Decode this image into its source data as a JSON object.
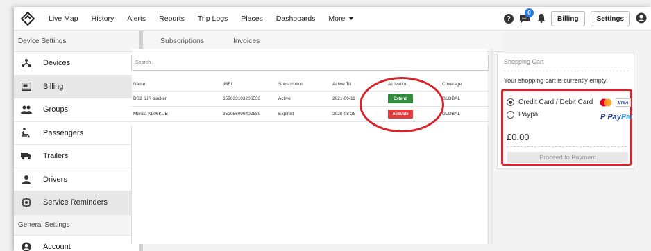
{
  "topnav": {
    "items": [
      "Live Map",
      "History",
      "Alerts",
      "Reports",
      "Trip Logs",
      "Places",
      "Dashboards"
    ],
    "more_label": "More",
    "notification_count": "0",
    "billing_label": "Billing",
    "settings_label": "Settings"
  },
  "sidebar": {
    "device_header": "Device Settings",
    "device_items": [
      {
        "label": "Devices",
        "icon": "devices-icon"
      },
      {
        "label": "Billing",
        "icon": "billing-icon"
      },
      {
        "label": "Groups",
        "icon": "groups-icon"
      },
      {
        "label": "Passengers",
        "icon": "passengers-icon"
      },
      {
        "label": "Trailers",
        "icon": "trailer-icon"
      },
      {
        "label": "Drivers",
        "icon": "driver-icon"
      },
      {
        "label": "Service Reminders",
        "icon": "service-icon"
      }
    ],
    "general_header": "General Settings",
    "general_items": [
      {
        "label": "Account",
        "icon": "account-icon"
      }
    ],
    "active_item": "Billing"
  },
  "tabs": [
    "Subscriptions",
    "Invoices"
  ],
  "search": {
    "placeholder": "Search.."
  },
  "table": {
    "headers": [
      "Name",
      "IMEI",
      "Subscription",
      "Active Till",
      "Activation",
      "Coverage"
    ],
    "rows": [
      {
        "name": "DB2 ILIR tracker",
        "imei": "359633103206533",
        "subscription": "Active",
        "active_till": "2021-06-11",
        "activation": "Extend",
        "coverage": "GLOBAL"
      },
      {
        "name": "Merica KL06KUB",
        "imei": "352056090402880",
        "subscription": "Expired",
        "active_till": "2020-08-28",
        "activation": "Activate",
        "coverage": "GLOBAL"
      }
    ]
  },
  "cart": {
    "title": "Shopping Cart",
    "empty_message": "Your shopping cart is currently empty.",
    "payment_options": [
      "Credit Card / Debit Card",
      "Paypal"
    ],
    "selected_option": "Credit Card / Debit Card",
    "total": "£0.00",
    "proceed_label": "Proceed to Payment",
    "visa_label": "VISA",
    "paypal_brand": [
      "Pay",
      "Pal"
    ]
  },
  "colors": {
    "accent": "#2a7de1",
    "highlight": "#d8232a",
    "extend": "#2e8b3a",
    "activate": "#e23c3c"
  }
}
